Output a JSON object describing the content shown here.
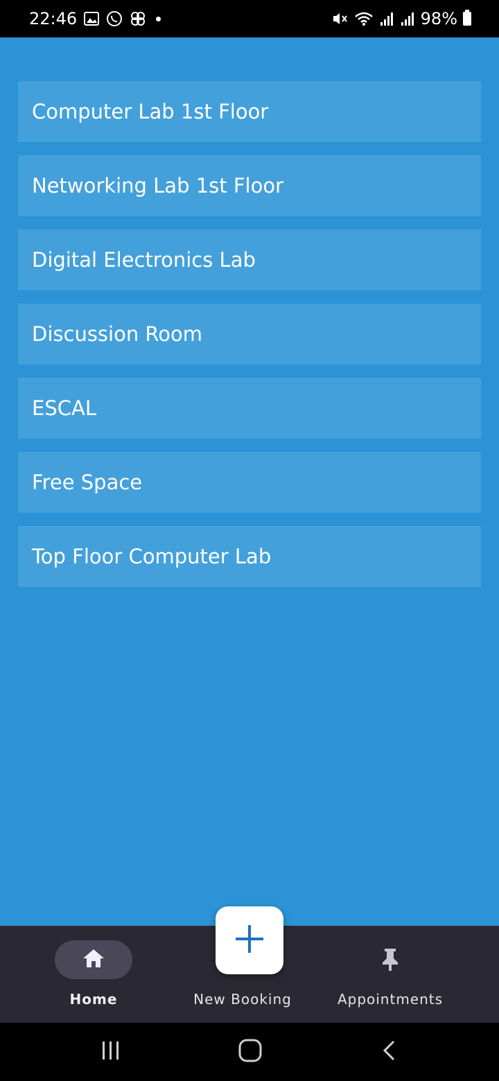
{
  "status_bar": {
    "time": "22:46",
    "battery": "98%",
    "icons_left": [
      "gallery-icon",
      "whatsapp-icon",
      "app-icon",
      "notification-dot"
    ],
    "icons_right": [
      "mute-icon",
      "wifi-icon",
      "signal-icon",
      "signal-icon",
      "battery-icon"
    ]
  },
  "rooms": [
    {
      "label": "Computer Lab 1st Floor"
    },
    {
      "label": "Networking Lab 1st Floor"
    },
    {
      "label": "Digital Electronics Lab"
    },
    {
      "label": "Discussion Room"
    },
    {
      "label": "ESCAL"
    },
    {
      "label": "Free Space"
    },
    {
      "label": "Top Floor Computer Lab"
    }
  ],
  "bottom_nav": {
    "home": "Home",
    "new_booking": "New Booking",
    "appointments": "Appointments",
    "active": "Home"
  },
  "colors": {
    "background": "#2b93d6",
    "list_item": "#44a0da",
    "nav_bar": "#2a2833",
    "fab_icon": "#1f6fc0"
  }
}
